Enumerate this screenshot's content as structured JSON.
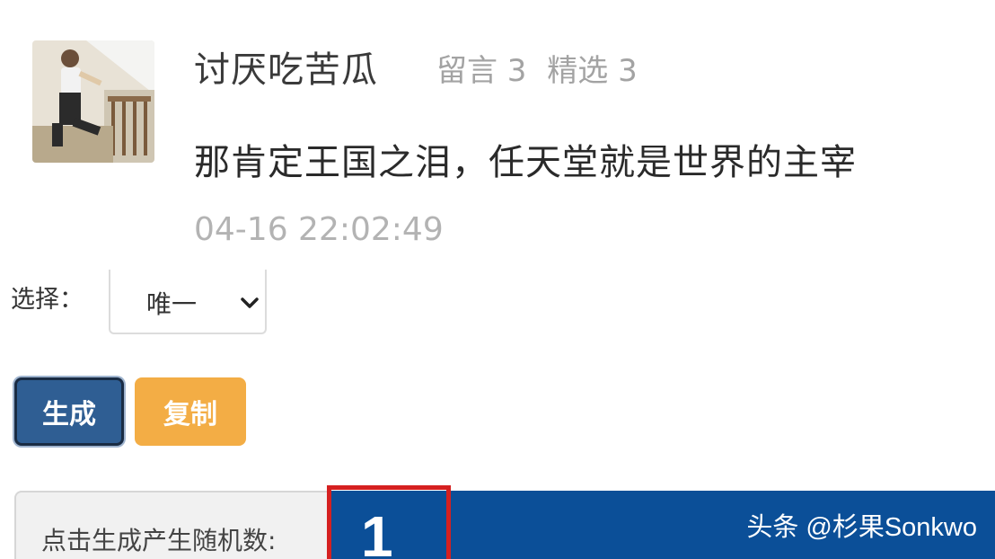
{
  "comment_card": {
    "username": "讨厌吃苦瓜",
    "stats": {
      "messages_label": "留言 3",
      "featured_label": "精选 3"
    },
    "text": "那肯定王国之泪，任天堂就是世界的主宰",
    "timestamp": "04-16 22:02:49"
  },
  "form": {
    "select_label": "选择：",
    "select_value": "唯一",
    "generate_label": "生成",
    "copy_label": "复制",
    "result_label": "点击生成产生随机数:",
    "result_value": "1"
  },
  "watermark": "头条 @杉果Sonkwo",
  "colors": {
    "generate_button": "#2f5e93",
    "copy_button": "#f3ad45",
    "result_bar": "#0b4f98",
    "highlight_border": "#d52020"
  }
}
